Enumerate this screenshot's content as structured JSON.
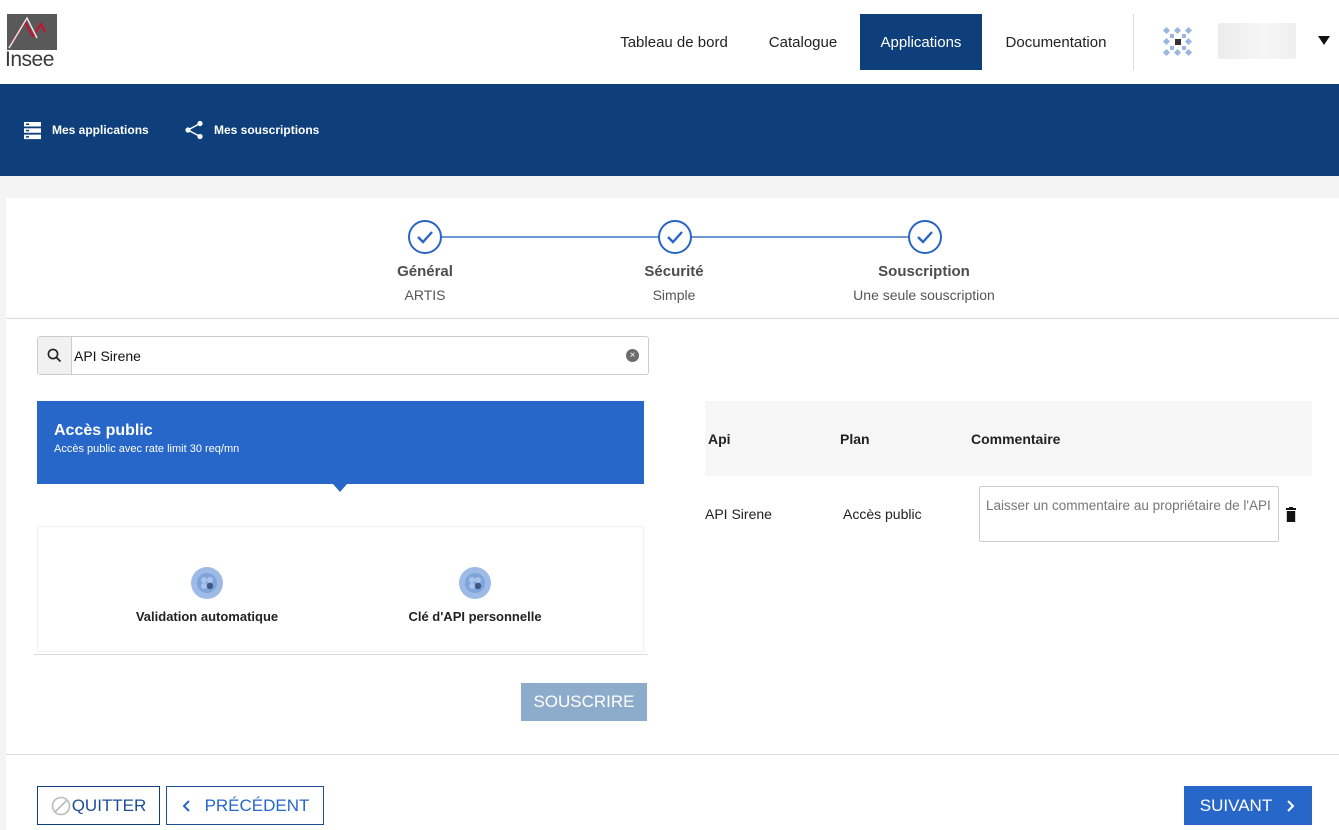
{
  "header": {
    "logo_text": "Insee",
    "nav": [
      {
        "label": "Tableau de bord",
        "active": false
      },
      {
        "label": "Catalogue",
        "active": false
      },
      {
        "label": "Applications",
        "active": true
      },
      {
        "label": "Documentation",
        "active": false
      }
    ],
    "active_color": "#0e3f7b"
  },
  "subnav": {
    "items": [
      {
        "label": "Mes applications",
        "icon": "server-list-icon"
      },
      {
        "label": "Mes souscriptions",
        "icon": "share-icon"
      }
    ]
  },
  "stepper": {
    "steps": [
      {
        "title": "Général",
        "subtitle": "ARTIS",
        "done": true
      },
      {
        "title": "Sécurité",
        "subtitle": "Simple",
        "done": true
      },
      {
        "title": "Souscription",
        "subtitle": "Une seule souscription",
        "done": true
      }
    ]
  },
  "search": {
    "value": "API Sirene",
    "icon": "search-icon"
  },
  "plan": {
    "title": "Accès public",
    "description": "Accès public avec rate limit 30 req/mn",
    "color": "#2767c9",
    "features": [
      {
        "label": "Validation automatique"
      },
      {
        "label": "Clé d'API personnelle"
      }
    ],
    "subscribe_label": "SOUSCRIRE"
  },
  "subscriptions_table": {
    "columns": [
      "Api",
      "Plan",
      "Commentaire"
    ],
    "rows": [
      {
        "api": "API Sirene",
        "plan": "Accès public",
        "comment_placeholder": "Laisser un commentaire au propriétaire de l'API"
      }
    ]
  },
  "footer": {
    "quit_label": "QUITTER",
    "prev_label": "PRÉCÉDENT",
    "next_label": "SUIVANT"
  }
}
